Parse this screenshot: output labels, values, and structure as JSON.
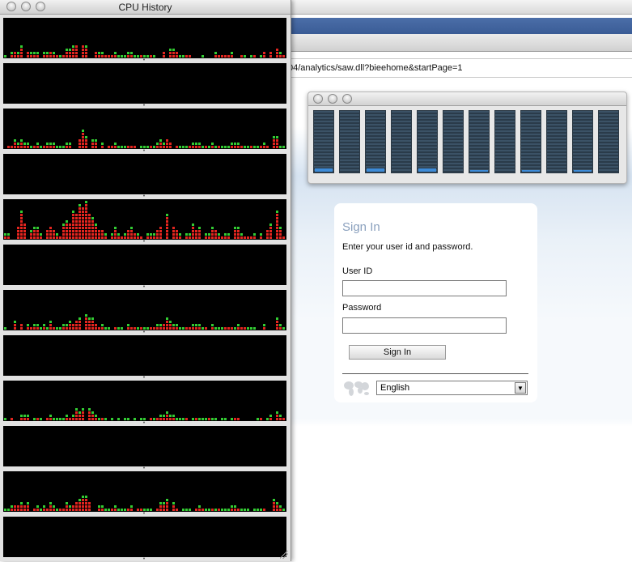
{
  "browser": {
    "address": "04/analytics/saw.dll?bieehome&startPage=1"
  },
  "login": {
    "title": "Sign In",
    "instruction": "Enter your user id and password.",
    "user_label": "User ID",
    "user_value": "",
    "password_label": "Password",
    "password_value": "",
    "sign_in_label": "Sign In",
    "language_selected": "English"
  },
  "cpu_meter": {
    "core_levels": [
      0.05,
      0.0,
      0.05,
      0.0,
      0.05,
      0.0,
      0.03,
      0.0,
      0.03,
      0.0,
      0.03,
      0.0
    ]
  },
  "cpu_history": {
    "title": "CPU History",
    "colors": {
      "user": "#e3251f",
      "system": "#33cc33",
      "background": "#000000"
    },
    "activity_profile": [
      1,
      2,
      3,
      4,
      3,
      2,
      2,
      1,
      2,
      3,
      2,
      1,
      2,
      3,
      4,
      5,
      6,
      5,
      4,
      3,
      2,
      1,
      1,
      2,
      1,
      1,
      2,
      1,
      1,
      1,
      1,
      1,
      2,
      3,
      4,
      3,
      2,
      1,
      1,
      1,
      2,
      2,
      1,
      1,
      2,
      1,
      1,
      1,
      2,
      2,
      1,
      1,
      1,
      1,
      1,
      2,
      3,
      4,
      2,
      1
    ],
    "panel_peaks": [
      6,
      0,
      5,
      0,
      12,
      0,
      5,
      0,
      4,
      0,
      5,
      0
    ]
  }
}
